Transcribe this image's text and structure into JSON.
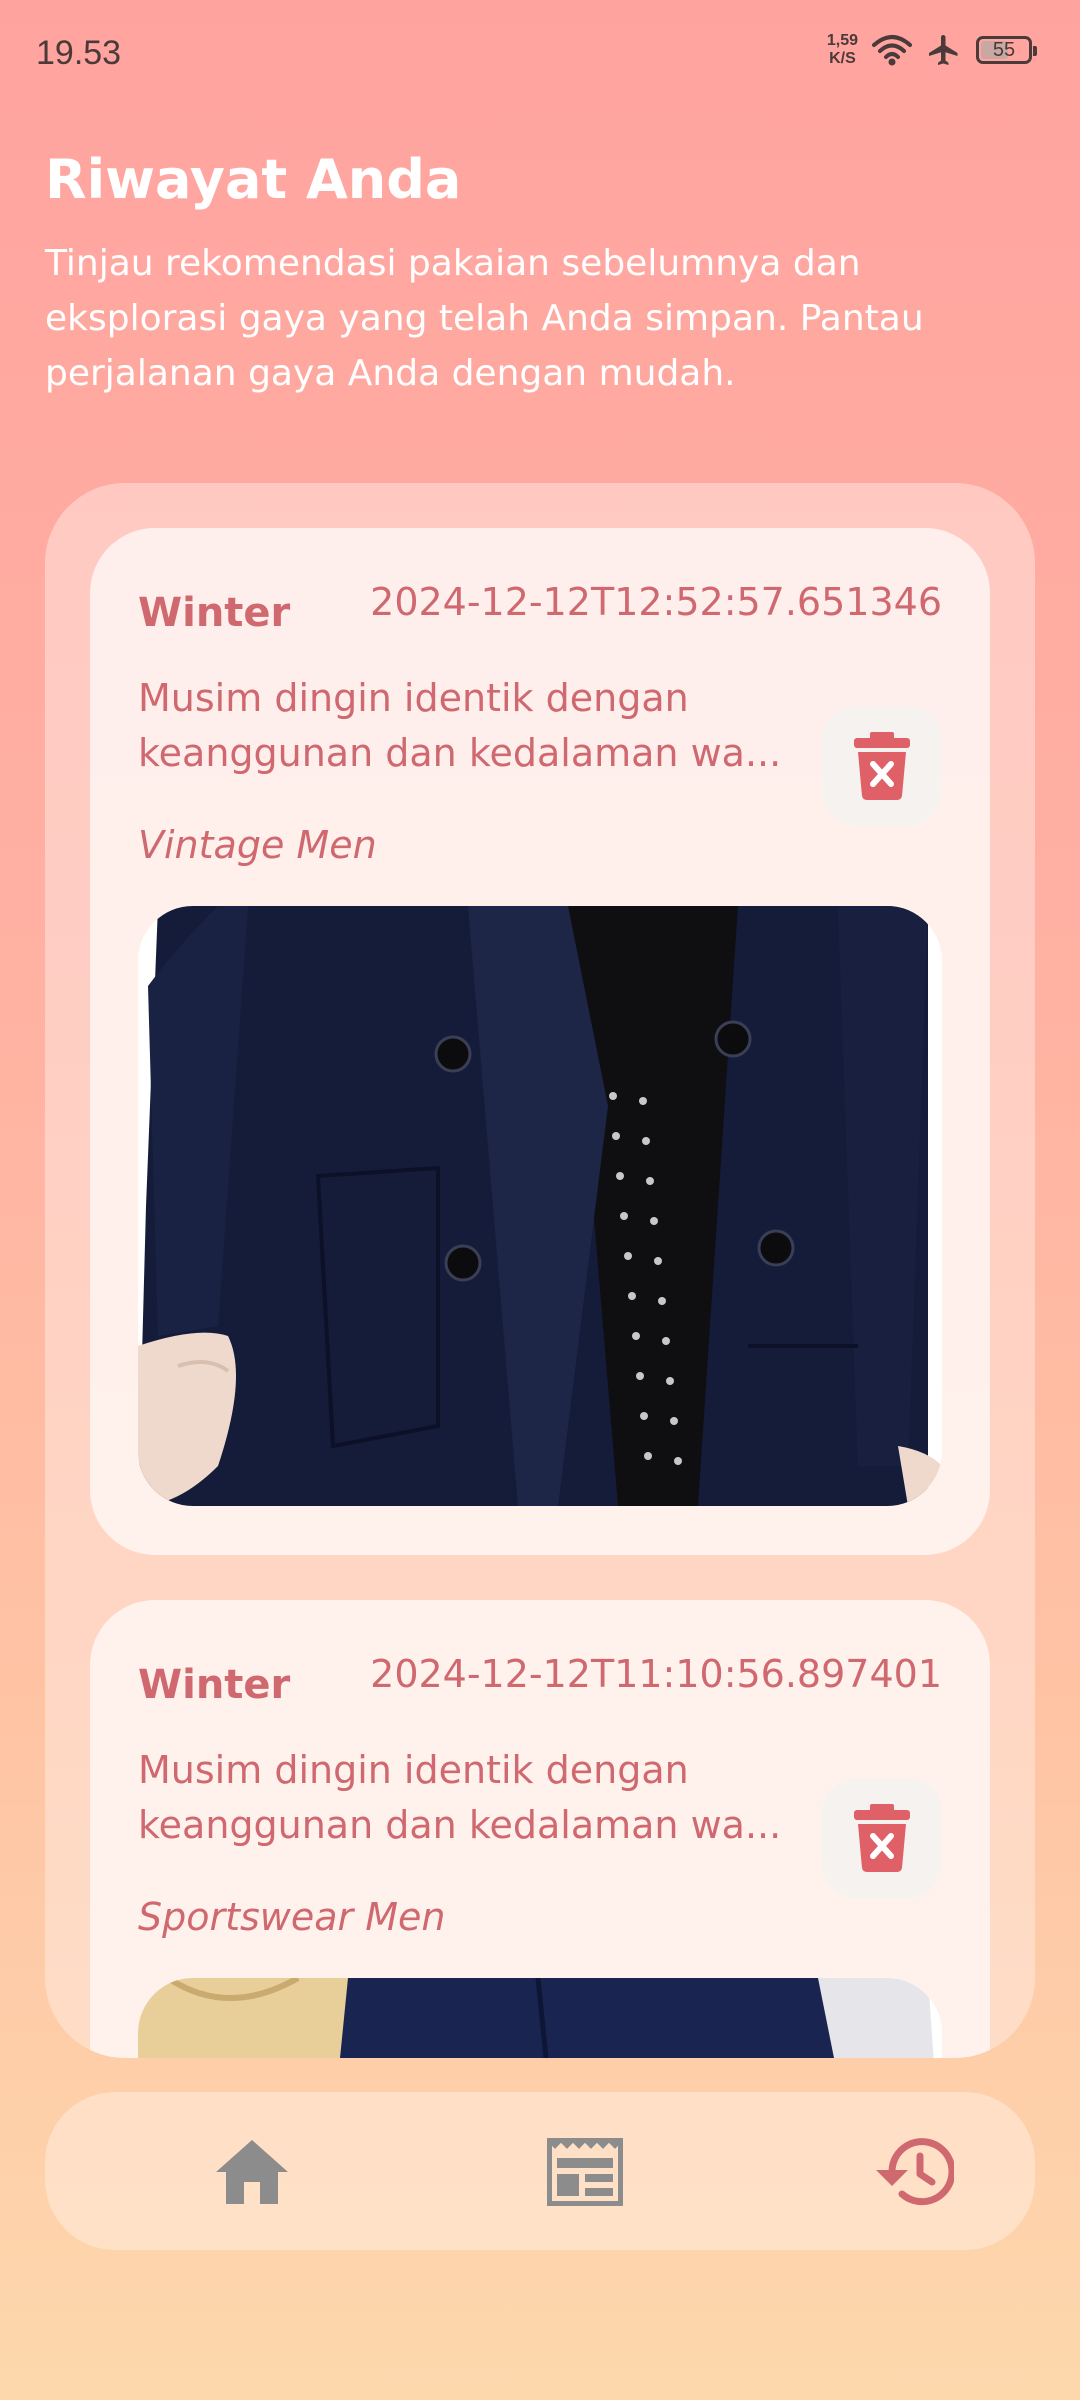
{
  "status_bar": {
    "time": "19.53",
    "net_speed_value": "1,59",
    "net_speed_unit": "K/S",
    "battery": "55"
  },
  "header": {
    "title": "Riwayat Anda",
    "subtitle": "Tinjau rekomendasi pakaian sebelumnya dan eksplorasi gaya yang telah Anda simpan. Pantau perjalanan gaya Anda dengan mudah."
  },
  "history": [
    {
      "season": "Winter",
      "timestamp": "2024-12-12T12:52:57.651346",
      "description_line1": "Musim dingin identik dengan",
      "description_line2": "keanggunan dan kedalaman wa...",
      "style": "Vintage Men"
    },
    {
      "season": "Winter",
      "timestamp": "2024-12-12T11:10:56.897401",
      "description_line1": "Musim dingin identik dengan",
      "description_line2": "keanggunan dan kedalaman wa...",
      "style": "Sportswear Men"
    }
  ],
  "colors": {
    "accent": "#d06870",
    "nav_inactive": "#8c8c8c",
    "nav_active": "#d06870"
  },
  "nav": {
    "items": [
      "home-icon",
      "feed-icon",
      "history-icon"
    ],
    "active": "history-icon"
  }
}
